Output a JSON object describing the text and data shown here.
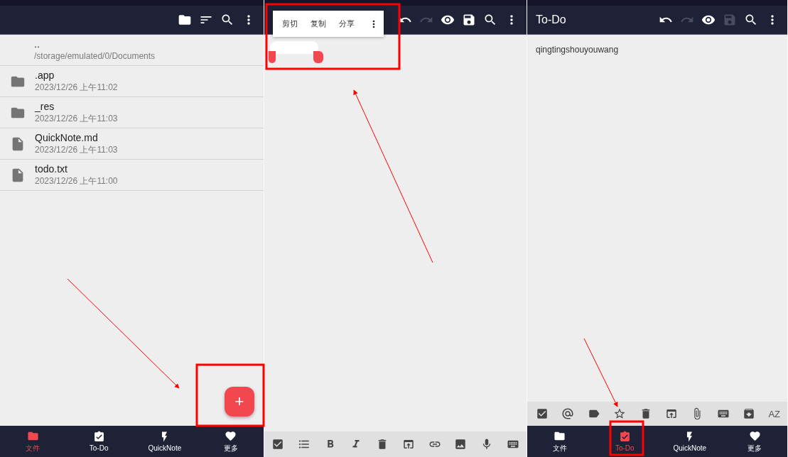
{
  "file_browser": {
    "parent": {
      "name": "..",
      "path": "/storage/emulated/0/Documents"
    },
    "files": [
      {
        "kind": "folder",
        "name": ".app",
        "date": "2023/12/26 上午11:02"
      },
      {
        "kind": "folder",
        "name": "_res",
        "date": "2023/12/26 上午11:03"
      },
      {
        "kind": "file",
        "name": "QuickNote.md",
        "date": "2023/12/26 上午11:03"
      },
      {
        "kind": "file",
        "name": "todo.txt",
        "date": "2023/12/26 上午11:00"
      }
    ],
    "fab": "+",
    "nav": [
      {
        "label": "文件",
        "selected": true
      },
      {
        "label": "To-Do",
        "selected": false
      },
      {
        "label": "QuickNote",
        "selected": false
      },
      {
        "label": "更多",
        "selected": false
      }
    ]
  },
  "editor": {
    "context_menu": [
      "剪切",
      "复制",
      "分享"
    ],
    "save_enabled": true
  },
  "todo": {
    "title": "To-Do",
    "save_enabled": false,
    "content": "qingtingshouyouwang",
    "sort_label": "AZ",
    "nav": [
      {
        "label": "文件",
        "selected": false
      },
      {
        "label": "To-Do",
        "selected": true
      },
      {
        "label": "QuickNote",
        "selected": false
      },
      {
        "label": "更多",
        "selected": false
      }
    ]
  }
}
